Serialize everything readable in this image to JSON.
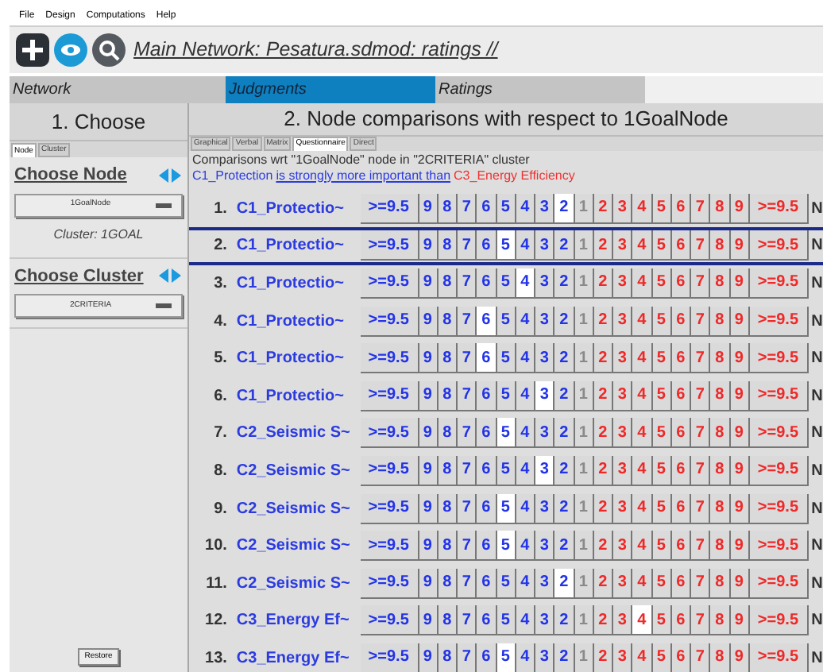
{
  "menu": [
    "File",
    "Design",
    "Computations",
    "Help"
  ],
  "toolbar": {
    "title": "Main Network: Pesatura.sdmod: ratings //"
  },
  "tabs": [
    {
      "label": "Network",
      "selected": false
    },
    {
      "label": "Judgments",
      "selected": true
    },
    {
      "label": "Ratings",
      "selected": false
    }
  ],
  "left_panel": {
    "header": "1. Choose",
    "subtabs": [
      {
        "label": "Node",
        "selected": true
      },
      {
        "label": "Cluster",
        "selected": false
      }
    ],
    "node_label": "Choose Node",
    "node_value": "1GoalNode",
    "cluster_info": "Cluster: 1GOAL",
    "cluster_label": "Choose Cluster",
    "cluster_value": "2CRITERIA",
    "restore": "Restore"
  },
  "right_panel": {
    "header": "2. Node comparisons with respect to 1GoalNode",
    "subtabs": [
      {
        "label": "Graphical",
        "selected": false
      },
      {
        "label": "Verbal",
        "selected": false
      },
      {
        "label": "Matrix",
        "selected": false
      },
      {
        "label": "Questionnaire",
        "selected": true
      },
      {
        "label": "Direct",
        "selected": false
      }
    ],
    "caption": "Comparisons wrt \"1GoalNode\" node in \"2CRITERIA\" cluster",
    "legend": {
      "left_node": "C1_Protection",
      "phrase": "is strongly more important than",
      "right_node": "C3_Energy Efficiency"
    },
    "rows": [
      {
        "number": "1.",
        "name": "C1_Protectio~",
        "focused": false,
        "left_cells": [
          {
            "label": ">=9.5",
            "selected": false
          },
          {
            "label": "9",
            "selected": false
          },
          {
            "label": "8",
            "selected": false
          },
          {
            "label": "7",
            "selected": false
          },
          {
            "label": "6",
            "selected": false
          },
          {
            "label": "5",
            "selected": false
          },
          {
            "label": "4",
            "selected": false
          },
          {
            "label": "3",
            "selected": false
          },
          {
            "label": "2",
            "selected": true
          }
        ],
        "equal_cell": "1",
        "right_cells": [
          {
            "label": "2",
            "selected": false
          },
          {
            "label": "3",
            "selected": false
          },
          {
            "label": "4",
            "selected": false
          },
          {
            "label": "5",
            "selected": false
          },
          {
            "label": "6",
            "selected": false
          },
          {
            "label": "7",
            "selected": false
          },
          {
            "label": "8",
            "selected": false
          },
          {
            "label": "9",
            "selected": false
          },
          {
            "label": ">=9.5",
            "selected": false
          }
        ],
        "tail": "N"
      },
      {
        "number": "2.",
        "name": "C1_Protectio~",
        "focused": true,
        "left_cells": [
          {
            "label": ">=9.5",
            "selected": false
          },
          {
            "label": "9",
            "selected": false
          },
          {
            "label": "8",
            "selected": false
          },
          {
            "label": "7",
            "selected": false
          },
          {
            "label": "6",
            "selected": false
          },
          {
            "label": "5",
            "selected": true
          },
          {
            "label": "4",
            "selected": false
          },
          {
            "label": "3",
            "selected": false
          },
          {
            "label": "2",
            "selected": false
          }
        ],
        "equal_cell": "1",
        "right_cells": [
          {
            "label": "2",
            "selected": false
          },
          {
            "label": "3",
            "selected": false
          },
          {
            "label": "4",
            "selected": false
          },
          {
            "label": "5",
            "selected": false
          },
          {
            "label": "6",
            "selected": false
          },
          {
            "label": "7",
            "selected": false
          },
          {
            "label": "8",
            "selected": false
          },
          {
            "label": "9",
            "selected": false
          },
          {
            "label": ">=9.5",
            "selected": false
          }
        ],
        "tail": "N"
      },
      {
        "number": "3.",
        "name": "C1_Protectio~",
        "focused": false,
        "left_cells": [
          {
            "label": ">=9.5",
            "selected": false
          },
          {
            "label": "9",
            "selected": false
          },
          {
            "label": "8",
            "selected": false
          },
          {
            "label": "7",
            "selected": false
          },
          {
            "label": "6",
            "selected": false
          },
          {
            "label": "5",
            "selected": false
          },
          {
            "label": "4",
            "selected": true
          },
          {
            "label": "3",
            "selected": false
          },
          {
            "label": "2",
            "selected": false
          }
        ],
        "equal_cell": "1",
        "right_cells": [
          {
            "label": "2",
            "selected": false
          },
          {
            "label": "3",
            "selected": false
          },
          {
            "label": "4",
            "selected": false
          },
          {
            "label": "5",
            "selected": false
          },
          {
            "label": "6",
            "selected": false
          },
          {
            "label": "7",
            "selected": false
          },
          {
            "label": "8",
            "selected": false
          },
          {
            "label": "9",
            "selected": false
          },
          {
            "label": ">=9.5",
            "selected": false
          }
        ],
        "tail": "N"
      },
      {
        "number": "4.",
        "name": "C1_Protectio~",
        "focused": false,
        "left_cells": [
          {
            "label": ">=9.5",
            "selected": false
          },
          {
            "label": "9",
            "selected": false
          },
          {
            "label": "8",
            "selected": false
          },
          {
            "label": "7",
            "selected": false
          },
          {
            "label": "6",
            "selected": true
          },
          {
            "label": "5",
            "selected": false
          },
          {
            "label": "4",
            "selected": false
          },
          {
            "label": "3",
            "selected": false
          },
          {
            "label": "2",
            "selected": false
          }
        ],
        "equal_cell": "1",
        "right_cells": [
          {
            "label": "2",
            "selected": false
          },
          {
            "label": "3",
            "selected": false
          },
          {
            "label": "4",
            "selected": false
          },
          {
            "label": "5",
            "selected": false
          },
          {
            "label": "6",
            "selected": false
          },
          {
            "label": "7",
            "selected": false
          },
          {
            "label": "8",
            "selected": false
          },
          {
            "label": "9",
            "selected": false
          },
          {
            "label": ">=9.5",
            "selected": false
          }
        ],
        "tail": "N"
      },
      {
        "number": "5.",
        "name": "C1_Protectio~",
        "focused": false,
        "left_cells": [
          {
            "label": ">=9.5",
            "selected": false
          },
          {
            "label": "9",
            "selected": false
          },
          {
            "label": "8",
            "selected": false
          },
          {
            "label": "7",
            "selected": false
          },
          {
            "label": "6",
            "selected": true
          },
          {
            "label": "5",
            "selected": false
          },
          {
            "label": "4",
            "selected": false
          },
          {
            "label": "3",
            "selected": false
          },
          {
            "label": "2",
            "selected": false
          }
        ],
        "equal_cell": "1",
        "right_cells": [
          {
            "label": "2",
            "selected": false
          },
          {
            "label": "3",
            "selected": false
          },
          {
            "label": "4",
            "selected": false
          },
          {
            "label": "5",
            "selected": false
          },
          {
            "label": "6",
            "selected": false
          },
          {
            "label": "7",
            "selected": false
          },
          {
            "label": "8",
            "selected": false
          },
          {
            "label": "9",
            "selected": false
          },
          {
            "label": ">=9.5",
            "selected": false
          }
        ],
        "tail": "N"
      },
      {
        "number": "6.",
        "name": "C1_Protectio~",
        "focused": false,
        "left_cells": [
          {
            "label": ">=9.5",
            "selected": false
          },
          {
            "label": "9",
            "selected": false
          },
          {
            "label": "8",
            "selected": false
          },
          {
            "label": "7",
            "selected": false
          },
          {
            "label": "6",
            "selected": false
          },
          {
            "label": "5",
            "selected": false
          },
          {
            "label": "4",
            "selected": false
          },
          {
            "label": "3",
            "selected": true
          },
          {
            "label": "2",
            "selected": false
          }
        ],
        "equal_cell": "1",
        "right_cells": [
          {
            "label": "2",
            "selected": false
          },
          {
            "label": "3",
            "selected": false
          },
          {
            "label": "4",
            "selected": false
          },
          {
            "label": "5",
            "selected": false
          },
          {
            "label": "6",
            "selected": false
          },
          {
            "label": "7",
            "selected": false
          },
          {
            "label": "8",
            "selected": false
          },
          {
            "label": "9",
            "selected": false
          },
          {
            "label": ">=9.5",
            "selected": false
          }
        ],
        "tail": "N"
      },
      {
        "number": "7.",
        "name": "C2_Seismic S~",
        "focused": false,
        "left_cells": [
          {
            "label": ">=9.5",
            "selected": false
          },
          {
            "label": "9",
            "selected": false
          },
          {
            "label": "8",
            "selected": false
          },
          {
            "label": "7",
            "selected": false
          },
          {
            "label": "6",
            "selected": false
          },
          {
            "label": "5",
            "selected": true
          },
          {
            "label": "4",
            "selected": false
          },
          {
            "label": "3",
            "selected": false
          },
          {
            "label": "2",
            "selected": false
          }
        ],
        "equal_cell": "1",
        "right_cells": [
          {
            "label": "2",
            "selected": false
          },
          {
            "label": "3",
            "selected": false
          },
          {
            "label": "4",
            "selected": false
          },
          {
            "label": "5",
            "selected": false
          },
          {
            "label": "6",
            "selected": false
          },
          {
            "label": "7",
            "selected": false
          },
          {
            "label": "8",
            "selected": false
          },
          {
            "label": "9",
            "selected": false
          },
          {
            "label": ">=9.5",
            "selected": false
          }
        ],
        "tail": "N"
      },
      {
        "number": "8.",
        "name": "C2_Seismic S~",
        "focused": false,
        "left_cells": [
          {
            "label": ">=9.5",
            "selected": false
          },
          {
            "label": "9",
            "selected": false
          },
          {
            "label": "8",
            "selected": false
          },
          {
            "label": "7",
            "selected": false
          },
          {
            "label": "6",
            "selected": false
          },
          {
            "label": "5",
            "selected": false
          },
          {
            "label": "4",
            "selected": false
          },
          {
            "label": "3",
            "selected": true
          },
          {
            "label": "2",
            "selected": false
          }
        ],
        "equal_cell": "1",
        "right_cells": [
          {
            "label": "2",
            "selected": false
          },
          {
            "label": "3",
            "selected": false
          },
          {
            "label": "4",
            "selected": false
          },
          {
            "label": "5",
            "selected": false
          },
          {
            "label": "6",
            "selected": false
          },
          {
            "label": "7",
            "selected": false
          },
          {
            "label": "8",
            "selected": false
          },
          {
            "label": "9",
            "selected": false
          },
          {
            "label": ">=9.5",
            "selected": false
          }
        ],
        "tail": "N"
      },
      {
        "number": "9.",
        "name": "C2_Seismic S~",
        "focused": false,
        "left_cells": [
          {
            "label": ">=9.5",
            "selected": false
          },
          {
            "label": "9",
            "selected": false
          },
          {
            "label": "8",
            "selected": false
          },
          {
            "label": "7",
            "selected": false
          },
          {
            "label": "6",
            "selected": false
          },
          {
            "label": "5",
            "selected": true
          },
          {
            "label": "4",
            "selected": false
          },
          {
            "label": "3",
            "selected": false
          },
          {
            "label": "2",
            "selected": false
          }
        ],
        "equal_cell": "1",
        "right_cells": [
          {
            "label": "2",
            "selected": false
          },
          {
            "label": "3",
            "selected": false
          },
          {
            "label": "4",
            "selected": false
          },
          {
            "label": "5",
            "selected": false
          },
          {
            "label": "6",
            "selected": false
          },
          {
            "label": "7",
            "selected": false
          },
          {
            "label": "8",
            "selected": false
          },
          {
            "label": "9",
            "selected": false
          },
          {
            "label": ">=9.5",
            "selected": false
          }
        ],
        "tail": "N"
      },
      {
        "number": "10.",
        "name": "C2_Seismic S~",
        "focused": false,
        "left_cells": [
          {
            "label": ">=9.5",
            "selected": false
          },
          {
            "label": "9",
            "selected": false
          },
          {
            "label": "8",
            "selected": false
          },
          {
            "label": "7",
            "selected": false
          },
          {
            "label": "6",
            "selected": false
          },
          {
            "label": "5",
            "selected": true
          },
          {
            "label": "4",
            "selected": false
          },
          {
            "label": "3",
            "selected": false
          },
          {
            "label": "2",
            "selected": false
          }
        ],
        "equal_cell": "1",
        "right_cells": [
          {
            "label": "2",
            "selected": false
          },
          {
            "label": "3",
            "selected": false
          },
          {
            "label": "4",
            "selected": false
          },
          {
            "label": "5",
            "selected": false
          },
          {
            "label": "6",
            "selected": false
          },
          {
            "label": "7",
            "selected": false
          },
          {
            "label": "8",
            "selected": false
          },
          {
            "label": "9",
            "selected": false
          },
          {
            "label": ">=9.5",
            "selected": false
          }
        ],
        "tail": "N"
      },
      {
        "number": "11.",
        "name": "C2_Seismic S~",
        "focused": false,
        "left_cells": [
          {
            "label": ">=9.5",
            "selected": false
          },
          {
            "label": "9",
            "selected": false
          },
          {
            "label": "8",
            "selected": false
          },
          {
            "label": "7",
            "selected": false
          },
          {
            "label": "6",
            "selected": false
          },
          {
            "label": "5",
            "selected": false
          },
          {
            "label": "4",
            "selected": false
          },
          {
            "label": "3",
            "selected": false
          },
          {
            "label": "2",
            "selected": true
          }
        ],
        "equal_cell": "1",
        "right_cells": [
          {
            "label": "2",
            "selected": false
          },
          {
            "label": "3",
            "selected": false
          },
          {
            "label": "4",
            "selected": false
          },
          {
            "label": "5",
            "selected": false
          },
          {
            "label": "6",
            "selected": false
          },
          {
            "label": "7",
            "selected": false
          },
          {
            "label": "8",
            "selected": false
          },
          {
            "label": "9",
            "selected": false
          },
          {
            "label": ">=9.5",
            "selected": false
          }
        ],
        "tail": "N"
      },
      {
        "number": "12.",
        "name": "C3_Energy Ef~",
        "focused": false,
        "left_cells": [
          {
            "label": ">=9.5",
            "selected": false
          },
          {
            "label": "9",
            "selected": false
          },
          {
            "label": "8",
            "selected": false
          },
          {
            "label": "7",
            "selected": false
          },
          {
            "label": "6",
            "selected": false
          },
          {
            "label": "5",
            "selected": false
          },
          {
            "label": "4",
            "selected": false
          },
          {
            "label": "3",
            "selected": false
          },
          {
            "label": "2",
            "selected": false
          }
        ],
        "equal_cell": "1",
        "right_cells": [
          {
            "label": "2",
            "selected": false
          },
          {
            "label": "3",
            "selected": false
          },
          {
            "label": "4",
            "selected": true
          },
          {
            "label": "5",
            "selected": false
          },
          {
            "label": "6",
            "selected": false
          },
          {
            "label": "7",
            "selected": false
          },
          {
            "label": "8",
            "selected": false
          },
          {
            "label": "9",
            "selected": false
          },
          {
            "label": ">=9.5",
            "selected": false
          }
        ],
        "tail": "N"
      },
      {
        "number": "13.",
        "name": "C3_Energy Ef~",
        "focused": false,
        "left_cells": [
          {
            "label": ">=9.5",
            "selected": false
          },
          {
            "label": "9",
            "selected": false
          },
          {
            "label": "8",
            "selected": false
          },
          {
            "label": "7",
            "selected": false
          },
          {
            "label": "6",
            "selected": false
          },
          {
            "label": "5",
            "selected": true
          },
          {
            "label": "4",
            "selected": false
          },
          {
            "label": "3",
            "selected": false
          },
          {
            "label": "2",
            "selected": false
          }
        ],
        "equal_cell": "1",
        "right_cells": [
          {
            "label": "2",
            "selected": false
          },
          {
            "label": "3",
            "selected": false
          },
          {
            "label": "4",
            "selected": false
          },
          {
            "label": "5",
            "selected": false
          },
          {
            "label": "6",
            "selected": false
          },
          {
            "label": "7",
            "selected": false
          },
          {
            "label": "8",
            "selected": false
          },
          {
            "label": "9",
            "selected": false
          },
          {
            "label": ">=9.5",
            "selected": false
          }
        ],
        "tail": "N"
      }
    ]
  }
}
